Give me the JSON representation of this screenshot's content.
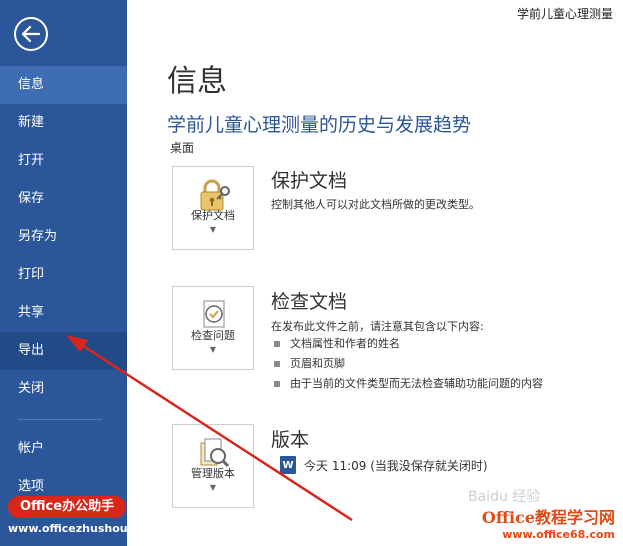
{
  "window": {
    "title": "学前儿童心理测量"
  },
  "sidebar": {
    "items": [
      {
        "label": "信息"
      },
      {
        "label": "新建"
      },
      {
        "label": "打开"
      },
      {
        "label": "保存"
      },
      {
        "label": "另存为"
      },
      {
        "label": "打印"
      },
      {
        "label": "共享"
      },
      {
        "label": "导出"
      },
      {
        "label": "关闭"
      },
      {
        "label": "帐户"
      },
      {
        "label": "选项"
      }
    ]
  },
  "main": {
    "page_title": "信息",
    "doc_title": "学前儿童心理测量的历史与发展趋势",
    "doc_location": "桌面",
    "protect": {
      "tile_label": "保护文档",
      "title": "保护文档",
      "desc": "控制其他人可以对此文档所做的更改类型。"
    },
    "inspect": {
      "tile_label": "检查问题",
      "title": "检查文档",
      "desc": "在发布此文件之前，请注意其包含以下内容:",
      "bullets": [
        "文档属性和作者的姓名",
        "页眉和页脚",
        "由于当前的文件类型而无法检查辅助功能问题的内容"
      ]
    },
    "versions": {
      "tile_label": "管理版本",
      "title": "版本",
      "entry": "今天 11:09 (当我没保存就关闭时)"
    }
  },
  "watermarks": {
    "left_badge": "Office办公助手",
    "left_url": "www.officezhushou.com",
    "right_brand": "Office教程学习网",
    "right_url": "www.office68.com",
    "center": "Baidu 经验"
  },
  "colors": {
    "sidebar": "#2b579a",
    "sidebar_active": "#3f6db3",
    "accent": "#2b579a",
    "annotation_arrow": "#d9261c"
  }
}
